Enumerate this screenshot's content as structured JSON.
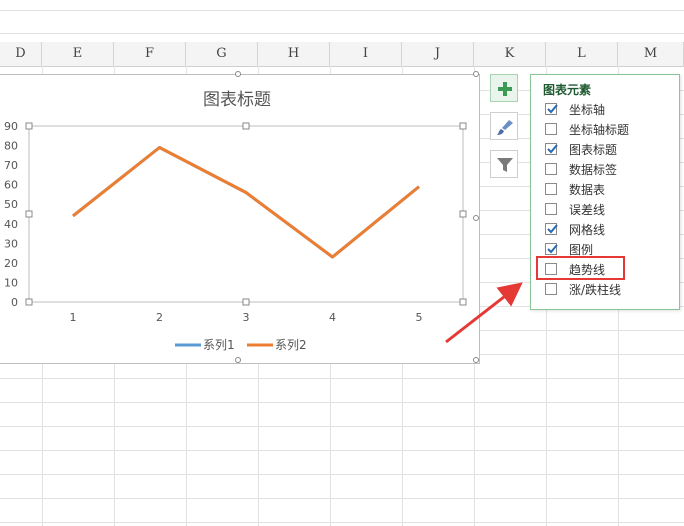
{
  "columns": [
    "D",
    "E",
    "F",
    "G",
    "H",
    "I",
    "J",
    "K",
    "L",
    "M"
  ],
  "chart": {
    "title": "图表标题",
    "legend": [
      "系列1",
      "系列2"
    ]
  },
  "chart_data": {
    "type": "line",
    "categories": [
      "1",
      "2",
      "3",
      "4",
      "5"
    ],
    "ylim": [
      0,
      90
    ],
    "yticks": [
      0,
      10,
      20,
      30,
      40,
      50,
      60,
      70,
      80,
      90
    ],
    "grid": false,
    "legend_position": "bottom",
    "series": [
      {
        "name": "系列1",
        "values": [
          44,
          79,
          56,
          23,
          59
        ],
        "color": "#5b9bd5"
      },
      {
        "name": "系列2",
        "values": [
          44,
          79,
          56,
          23,
          59
        ],
        "color": "#ed7d31"
      }
    ]
  },
  "side_buttons": {
    "add_icon": "plus-icon",
    "style_icon": "brush-icon",
    "filter_icon": "funnel-icon"
  },
  "panel": {
    "title": "图表元素",
    "items": [
      {
        "label": "坐标轴",
        "checked": true
      },
      {
        "label": "坐标轴标题",
        "checked": false
      },
      {
        "label": "图表标题",
        "checked": true
      },
      {
        "label": "数据标签",
        "checked": false
      },
      {
        "label": "数据表",
        "checked": false
      },
      {
        "label": "误差线",
        "checked": false
      },
      {
        "label": "网格线",
        "checked": true
      },
      {
        "label": "图例",
        "checked": true
      },
      {
        "label": "趋势线",
        "checked": false
      },
      {
        "label": "涨/跌柱线",
        "checked": false
      }
    ]
  },
  "colors": {
    "accent_green": "#5aa870",
    "highlight_red": "#e53935"
  }
}
